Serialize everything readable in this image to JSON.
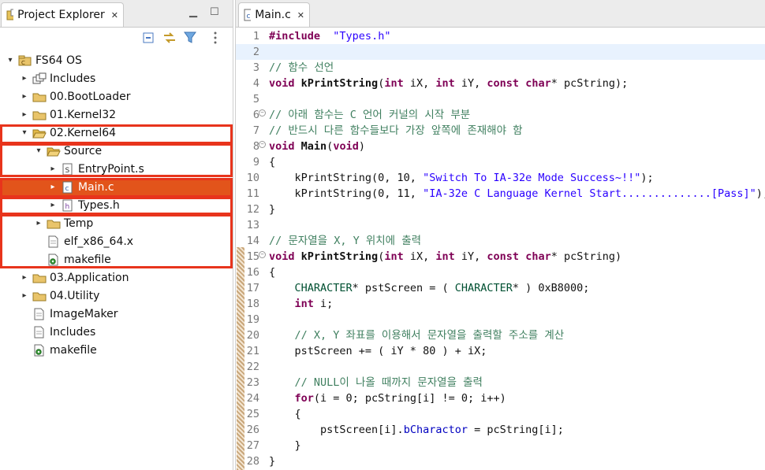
{
  "explorer": {
    "title": "Project Explorer",
    "tree": [
      {
        "label": "FS64 OS",
        "icon": "project-icon",
        "depth": 0,
        "twisty": "expanded"
      },
      {
        "label": "Includes",
        "icon": "includes-icon",
        "depth": 1,
        "twisty": "collapsed"
      },
      {
        "label": "00.BootLoader",
        "icon": "folder-icon",
        "depth": 1,
        "twisty": "collapsed"
      },
      {
        "label": "01.Kernel32",
        "icon": "folder-icon",
        "depth": 1,
        "twisty": "collapsed"
      },
      {
        "label": "02.Kernel64",
        "icon": "folder-open-icon",
        "depth": 1,
        "twisty": "expanded"
      },
      {
        "label": "Source",
        "icon": "folder-open-icon",
        "depth": 2,
        "twisty": "expanded"
      },
      {
        "label": "EntryPoint.s",
        "icon": "asm-file-icon",
        "depth": 3,
        "twisty": "collapsed"
      },
      {
        "label": "Main.c",
        "icon": "c-file-icon",
        "depth": 3,
        "twisty": "collapsed",
        "selected": true
      },
      {
        "label": "Types.h",
        "icon": "h-file-icon",
        "depth": 3,
        "twisty": "collapsed"
      },
      {
        "label": "Temp",
        "icon": "folder-icon",
        "depth": 2,
        "twisty": "collapsed"
      },
      {
        "label": "elf_x86_64.x",
        "icon": "file-icon",
        "depth": 2,
        "twisty": "none"
      },
      {
        "label": "makefile",
        "icon": "makefile-icon",
        "depth": 2,
        "twisty": "none"
      },
      {
        "label": "03.Application",
        "icon": "folder-icon",
        "depth": 1,
        "twisty": "collapsed"
      },
      {
        "label": "04.Utility",
        "icon": "folder-icon",
        "depth": 1,
        "twisty": "collapsed"
      },
      {
        "label": "ImageMaker",
        "icon": "file-icon",
        "depth": 1,
        "twisty": "none"
      },
      {
        "label": "Includes",
        "icon": "file-icon",
        "depth": 1,
        "twisty": "none"
      },
      {
        "label": "makefile",
        "icon": "makefile-icon",
        "depth": 1,
        "twisty": "none"
      }
    ]
  },
  "editor": {
    "tab_title": "Main.c",
    "lines": [
      {
        "n": "1",
        "tokens": [
          [
            "kw",
            "#include"
          ],
          [
            "",
            "  "
          ],
          [
            "str",
            "\"Types.h\""
          ]
        ]
      },
      {
        "n": "2",
        "tokens": [],
        "current": true
      },
      {
        "n": "3",
        "tokens": [
          [
            "cm",
            "// 함수 선언"
          ]
        ]
      },
      {
        "n": "4",
        "tokens": [
          [
            "kw",
            "void"
          ],
          [
            "",
            " "
          ],
          [
            "fn",
            "kPrintString"
          ],
          [
            "",
            "("
          ],
          [
            "kw",
            "int"
          ],
          [
            "",
            " iX, "
          ],
          [
            "kw",
            "int"
          ],
          [
            "",
            " iY, "
          ],
          [
            "kw",
            "const"
          ],
          [
            "",
            " "
          ],
          [
            "kw",
            "char"
          ],
          [
            "",
            "* pcString);"
          ]
        ]
      },
      {
        "n": "5",
        "tokens": []
      },
      {
        "n": "6",
        "fold": true,
        "tokens": [
          [
            "cm",
            "// 아래 함수는 C 언어 커널의 시작 부분"
          ]
        ]
      },
      {
        "n": "7",
        "tokens": [
          [
            "cm",
            "// 반드시 다른 함수들보다 가장 앞쪽에 존재해야 함"
          ]
        ]
      },
      {
        "n": "8",
        "fold": true,
        "tokens": [
          [
            "kw",
            "void"
          ],
          [
            "",
            " "
          ],
          [
            "fn",
            "Main"
          ],
          [
            "",
            "("
          ],
          [
            "kw",
            "void"
          ],
          [
            "",
            ")"
          ]
        ]
      },
      {
        "n": "9",
        "tokens": [
          [
            "",
            "{"
          ]
        ]
      },
      {
        "n": "10",
        "tokens": [
          [
            "",
            "    kPrintString(0, 10, "
          ],
          [
            "str",
            "\"Switch To IA-32e Mode Success~!!\""
          ],
          [
            "",
            ");"
          ]
        ]
      },
      {
        "n": "11",
        "tokens": [
          [
            "",
            "    kPrintString(0, 11, "
          ],
          [
            "str",
            "\"IA-32e C Language Kernel Start..............[Pass]\""
          ],
          [
            "",
            ");"
          ]
        ]
      },
      {
        "n": "12",
        "tokens": [
          [
            "",
            "}"
          ]
        ]
      },
      {
        "n": "13",
        "tokens": []
      },
      {
        "n": "14",
        "tokens": [
          [
            "cm",
            "// 문자열을 X, Y 위치에 출력"
          ]
        ]
      },
      {
        "n": "15",
        "fold": true,
        "tokens": [
          [
            "kw",
            "void"
          ],
          [
            "",
            " "
          ],
          [
            "fn",
            "kPrintString"
          ],
          [
            "",
            "("
          ],
          [
            "kw",
            "int"
          ],
          [
            "",
            " iX, "
          ],
          [
            "kw",
            "int"
          ],
          [
            "",
            " iY, "
          ],
          [
            "kw",
            "const"
          ],
          [
            "",
            " "
          ],
          [
            "kw",
            "char"
          ],
          [
            "",
            "* pcString)"
          ]
        ]
      },
      {
        "n": "16",
        "tokens": [
          [
            "",
            "{"
          ]
        ]
      },
      {
        "n": "17",
        "tokens": [
          [
            "",
            "    "
          ],
          [
            "ty",
            "CHARACTER"
          ],
          [
            "",
            "* pstScreen = ( "
          ],
          [
            "ty",
            "CHARACTER"
          ],
          [
            "",
            "* ) 0xB8000;"
          ]
        ]
      },
      {
        "n": "18",
        "tokens": [
          [
            "",
            "    "
          ],
          [
            "kw",
            "int"
          ],
          [
            "",
            " i;"
          ]
        ]
      },
      {
        "n": "19",
        "tokens": []
      },
      {
        "n": "20",
        "tokens": [
          [
            "",
            "    "
          ],
          [
            "cm",
            "// X, Y 좌표를 이용해서 문자열을 출력할 주소를 계산"
          ]
        ]
      },
      {
        "n": "21",
        "tokens": [
          [
            "",
            "    pstScreen += ( iY * 80 ) + iX;"
          ]
        ]
      },
      {
        "n": "22",
        "tokens": []
      },
      {
        "n": "23",
        "tokens": [
          [
            "",
            "    "
          ],
          [
            "cm",
            "// NULL이 나올 때까지 문자열을 출력"
          ]
        ]
      },
      {
        "n": "24",
        "tokens": [
          [
            "",
            "    "
          ],
          [
            "kw",
            "for"
          ],
          [
            "",
            "(i = 0; pcString[i] != 0; i++)"
          ]
        ]
      },
      {
        "n": "25",
        "tokens": [
          [
            "",
            "    {"
          ]
        ]
      },
      {
        "n": "26",
        "tokens": [
          [
            "",
            "        pstScreen[i]."
          ],
          [
            "fld",
            "bCharactor"
          ],
          [
            "",
            " = pcString[i];"
          ]
        ]
      },
      {
        "n": "27",
        "tokens": [
          [
            "",
            "    }"
          ]
        ]
      },
      {
        "n": "28",
        "tokens": [
          [
            "",
            "}"
          ]
        ]
      }
    ]
  },
  "colors": {
    "selection": "#e2541b",
    "highlight_box": "#e8341c"
  }
}
